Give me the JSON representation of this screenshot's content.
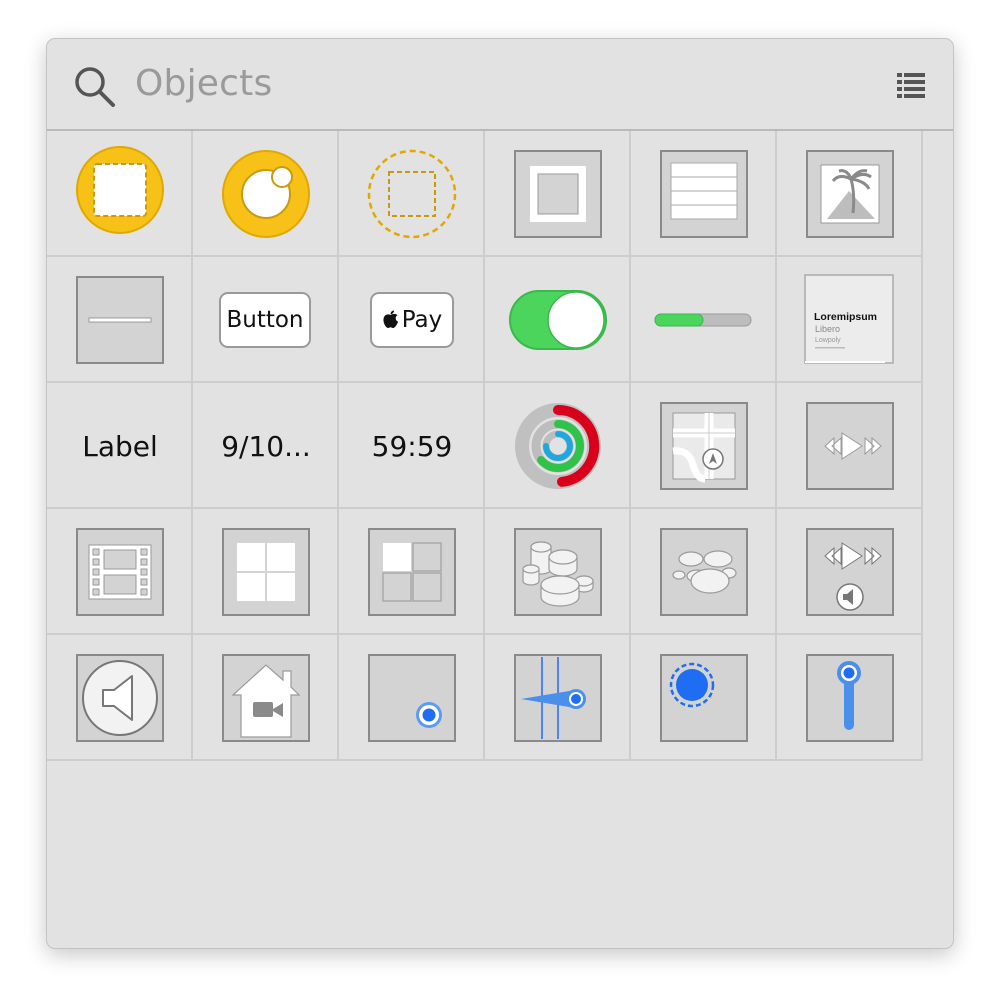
{
  "search": {
    "placeholder": "Objects"
  },
  "objects": {
    "button_label": "Button",
    "apple_pay_label": "Pay",
    "label_text": "Label",
    "date_text": "9/10...",
    "timer_text": "59:59",
    "text_preview": {
      "title": "Loremipsum",
      "line1": "Libero",
      "line2": "Lowpoly"
    },
    "slider_level": 0.5
  },
  "colors": {
    "accent_yellow": "#f7c117",
    "switch_green": "#4cd55d",
    "blue": "#1f6df2",
    "cell_bg": "#d3d3d3"
  }
}
